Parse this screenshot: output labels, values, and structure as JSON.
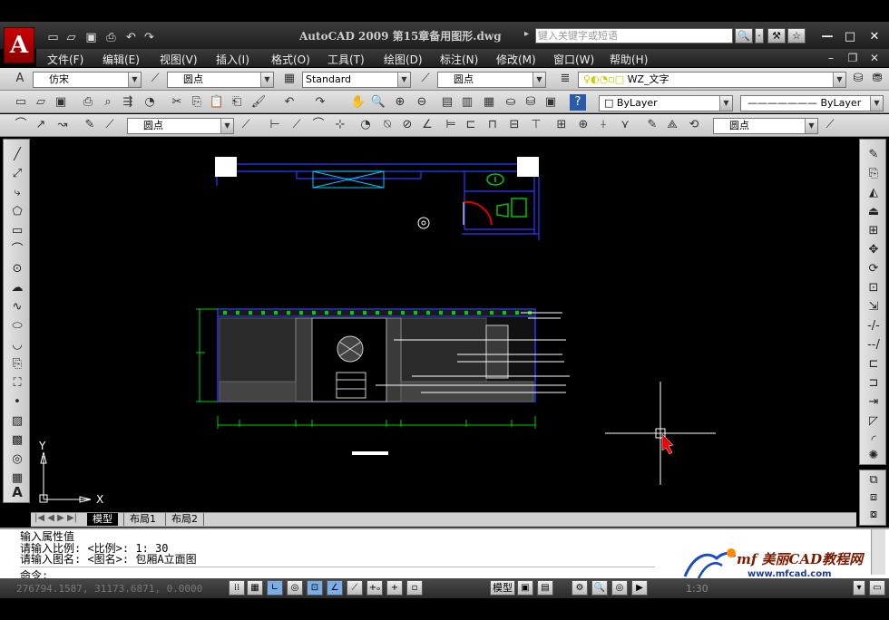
{
  "window": {
    "title": "AutoCAD  2009  第15章备用图形.dwg",
    "search_placeholder": "键入关键字或短语",
    "min": "—",
    "restore": "□",
    "close": "✕"
  },
  "menu": [
    "文件(F)",
    "编辑(E)",
    "视图(V)",
    "插入(I)",
    "格式(O)",
    "工具(T)",
    "绘图(D)",
    "标注(N)",
    "修改(M)",
    "窗口(W)",
    "帮助(H)"
  ],
  "toolbar_text": {
    "text_style_combo": "仿宋",
    "dim_style_combo": "圆点",
    "table_style_combo": "Standard",
    "mleader_style_combo": "圆点",
    "layer_combo": "WZ_文字"
  },
  "toolbar_props": {
    "color_combo": "ByLayer",
    "linetype_combo": "ByLayer"
  },
  "toolbar_dim": {
    "dimstyle_combo1": "圆点",
    "dimstyle_combo2": "圆点"
  },
  "ucs": {
    "x_label": "X",
    "y_label": "Y"
  },
  "tabs": {
    "model": "模型",
    "layout1": "布局1",
    "layout2": "布局2"
  },
  "command": {
    "line1": "输入属性值",
    "line2": "请输入比例: <比例>:  1: 30",
    "line3": "请输入图名: <图名>:  包厢A立面图",
    "prompt": "命令:"
  },
  "status": {
    "coords": "276794.1587, 31173.6871, 0.0000",
    "model": "模型",
    "scale": "1:30"
  },
  "watermark": {
    "text1": "mf 美丽CAD教程网",
    "url": "www.mfcad.com"
  },
  "colors": {
    "canvas": "#000000",
    "plan_lines": "#2a3cff",
    "green": "#00d000",
    "accent_red": "#cc0000"
  }
}
